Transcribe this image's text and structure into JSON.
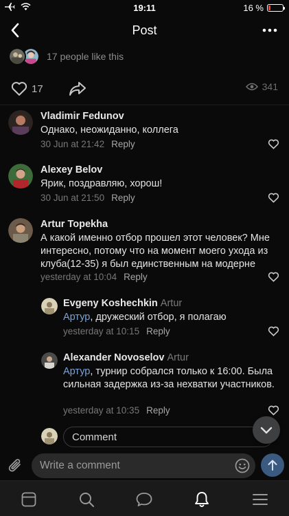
{
  "status": {
    "time": "19:11",
    "battery": "16 %",
    "battery_level": 0.16
  },
  "nav": {
    "title": "Post"
  },
  "likes": {
    "text": "17 people like this",
    "count": "17",
    "views": "341"
  },
  "comments": [
    {
      "name": "Vladimir Fedunov",
      "text": "Однако, неожиданно, коллега",
      "time": "30 Jun at 21:42",
      "reply": "Reply"
    },
    {
      "name": "Alexey Belov",
      "text": "Ярик, поздравляю, хорош!",
      "time": "30 Jun at 21:50",
      "reply": "Reply"
    },
    {
      "name": "Artur Topekha",
      "text": "А какой именно отбор прошел этот человек? Мне интересно, потому что на момент моего ухода из клуба(12-35) я был единственным на модерне",
      "time": "yesterday at 10:04",
      "reply": "Reply"
    },
    {
      "name": "Evgeny Koshechkin",
      "reply_to": "Artur",
      "mention": "Артур",
      "text": ", дружеский отбор, я полагаю",
      "time": "yesterday at 10:15",
      "reply": "Reply"
    },
    {
      "name": "Alexander Novoselov",
      "reply_to": "Artur",
      "mention": "Артур",
      "text": ", турнир собрался только к 16:00. Была сильная задержка из-за нехватки участников.",
      "time": "yesterday at 10:35",
      "reply": "Reply"
    }
  ],
  "reply_box": {
    "placeholder": "Comment"
  },
  "composer": {
    "placeholder": "Write a comment"
  },
  "colors": {
    "background": "#0a0a0a",
    "mention": "#7aa3d6",
    "send_button": "#3a5a80",
    "battery_low": "#ff3b30"
  },
  "icons": [
    "airplane-icon",
    "wifi-icon",
    "back-chevron-icon",
    "more-icon",
    "heart-icon",
    "share-icon",
    "eye-icon",
    "attach-icon",
    "emoji-icon",
    "send-icon",
    "chevron-down-icon",
    "newsfeed-icon",
    "search-icon",
    "messages-icon",
    "notifications-icon",
    "menu-icon"
  ]
}
